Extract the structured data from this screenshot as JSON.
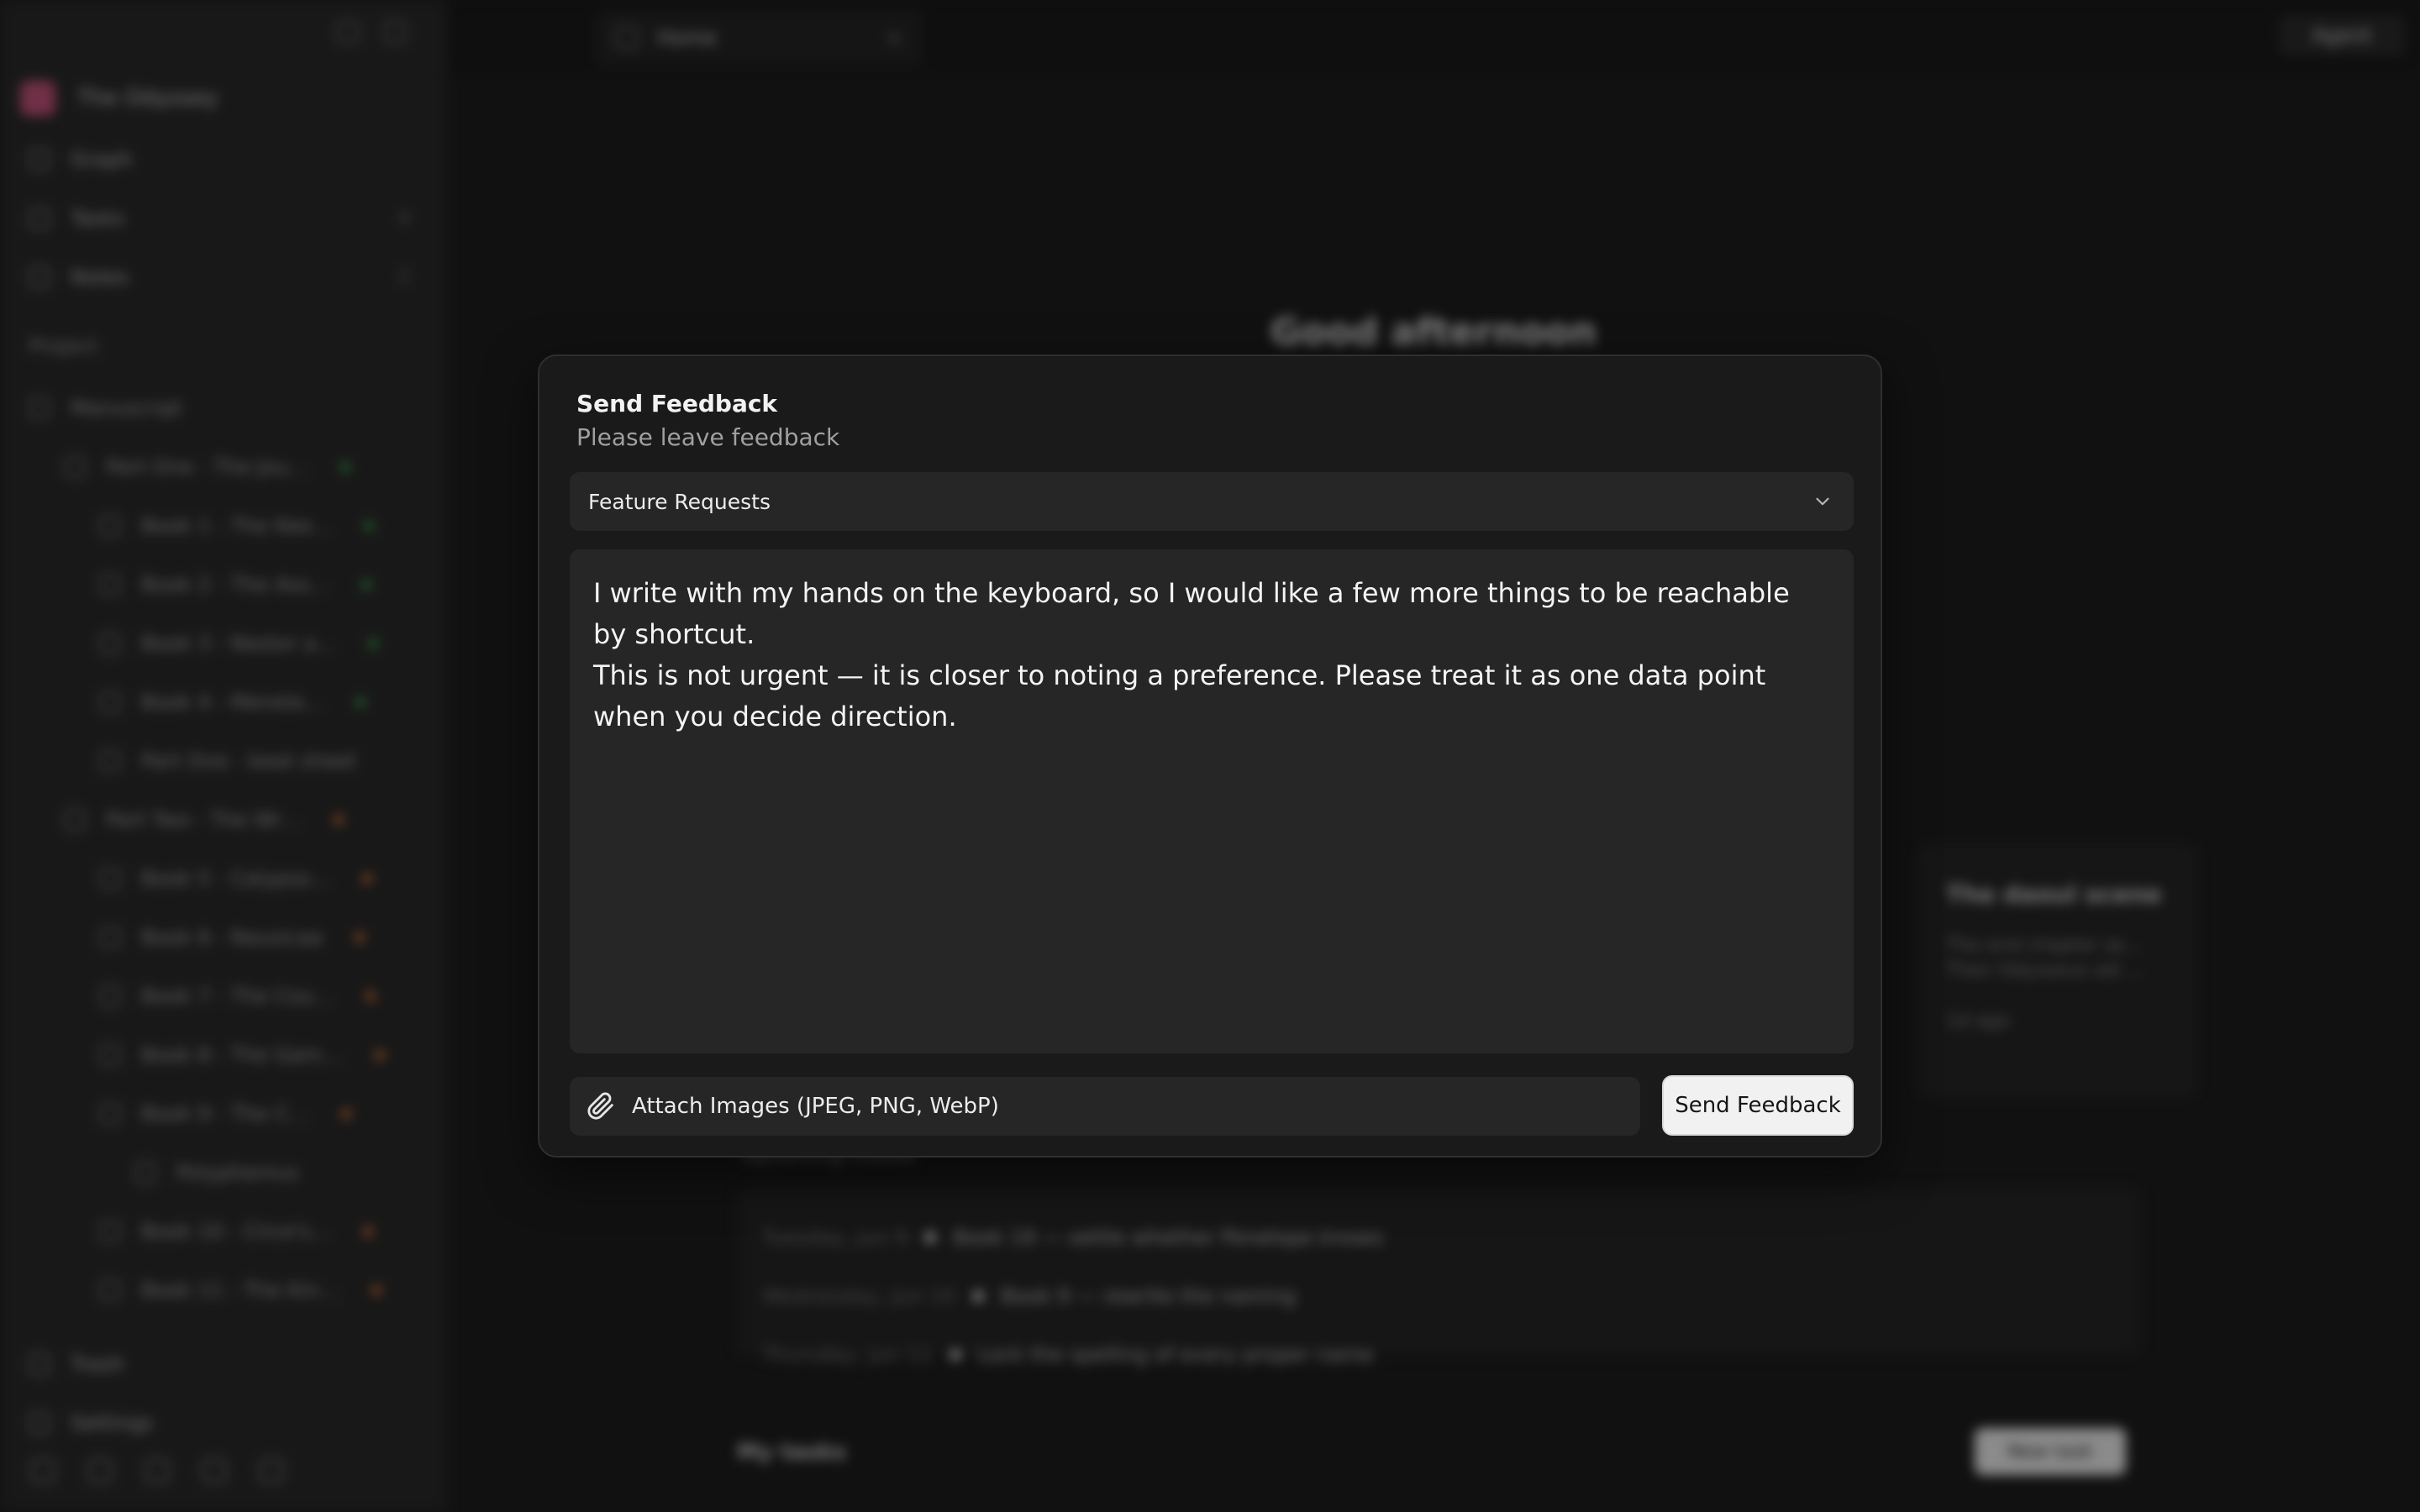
{
  "background": {
    "workspace_name": "The Odyssey",
    "nav": [
      {
        "label": "Graph",
        "count": ""
      },
      {
        "label": "Tasks",
        "count": "4"
      },
      {
        "label": "Notes",
        "count": "2"
      }
    ],
    "section_label": "Project",
    "tree": [
      {
        "label": "Manuscript",
        "indent": 0,
        "status": ""
      },
      {
        "label": "Part One - The Jou…",
        "indent": 1,
        "status": "green"
      },
      {
        "label": "Book 1 - The Kee…",
        "indent": 2,
        "status": "green"
      },
      {
        "label": "Book 2 - The Ass…",
        "indent": 2,
        "status": "green"
      },
      {
        "label": "Book 3 - Nestor a…",
        "indent": 2,
        "status": "green"
      },
      {
        "label": "Book 4 - Menela…",
        "indent": 2,
        "status": "green"
      },
      {
        "label": "Part One - beat sheet",
        "indent": 2,
        "status": ""
      },
      {
        "label": "Part Two - The Wr…",
        "indent": 1,
        "status": "orange"
      },
      {
        "label": "Book 5 - Calypso…",
        "indent": 2,
        "status": "orange"
      },
      {
        "label": "Book 6 - Nausicaa",
        "indent": 2,
        "status": "orange"
      },
      {
        "label": "Book 7 - The Cou…",
        "indent": 2,
        "status": "orange"
      },
      {
        "label": "Book 8 - The Gam…",
        "indent": 2,
        "status": "orange"
      },
      {
        "label": "Book 9 - The C…",
        "indent": 2,
        "status": "orange"
      },
      {
        "label": "Polyphemus",
        "indent": 3,
        "status": ""
      },
      {
        "label": "Book 10 - Circe's…",
        "indent": 2,
        "status": "orange"
      },
      {
        "label": "Book 11 - The Kin…",
        "indent": 2,
        "status": "orange"
      }
    ],
    "trash_label": "Trash",
    "settings_label": "Settings",
    "tab_label": "Home",
    "agent_label": "Agent",
    "greeting": "Good afternoon",
    "card_title": "The daoul scene",
    "card_text": "The end chapter as... Then Odysseus set ...",
    "card_time": "1d ago",
    "upcoming_title": "Upcoming chores",
    "upcoming": [
      {
        "date": "Tuesday, Jun 9",
        "text": "Book 19 — settle whether Penelope knows"
      },
      {
        "date": "Wednesday, Jun 10",
        "text": "Book 9 — rewrite the naming"
      },
      {
        "date": "Thursday, Jun 11",
        "text": "Lock the spelling of every proper name"
      }
    ],
    "my_tasks": "My tasks",
    "new_task": "New task"
  },
  "modal": {
    "title": "Send Feedback",
    "subtitle": "Please leave feedback",
    "category": "Feature Requests",
    "message_lines": [
      "I write with my hands on the keyboard, so I would like a few more things to be reachable by shortcut.",
      "This is not urgent — it is closer to noting a preference. Please treat it as one data point when you decide direction."
    ],
    "attach_label": "Attach Images (JPEG, PNG, WebP)",
    "send_label": "Send Feedback"
  },
  "colors": {
    "modal_bg": "#1a1a1a",
    "field_bg": "#262626",
    "primary_button": "#f1f1f1",
    "status_green": "#3fa34d",
    "status_orange": "#d9793a"
  }
}
